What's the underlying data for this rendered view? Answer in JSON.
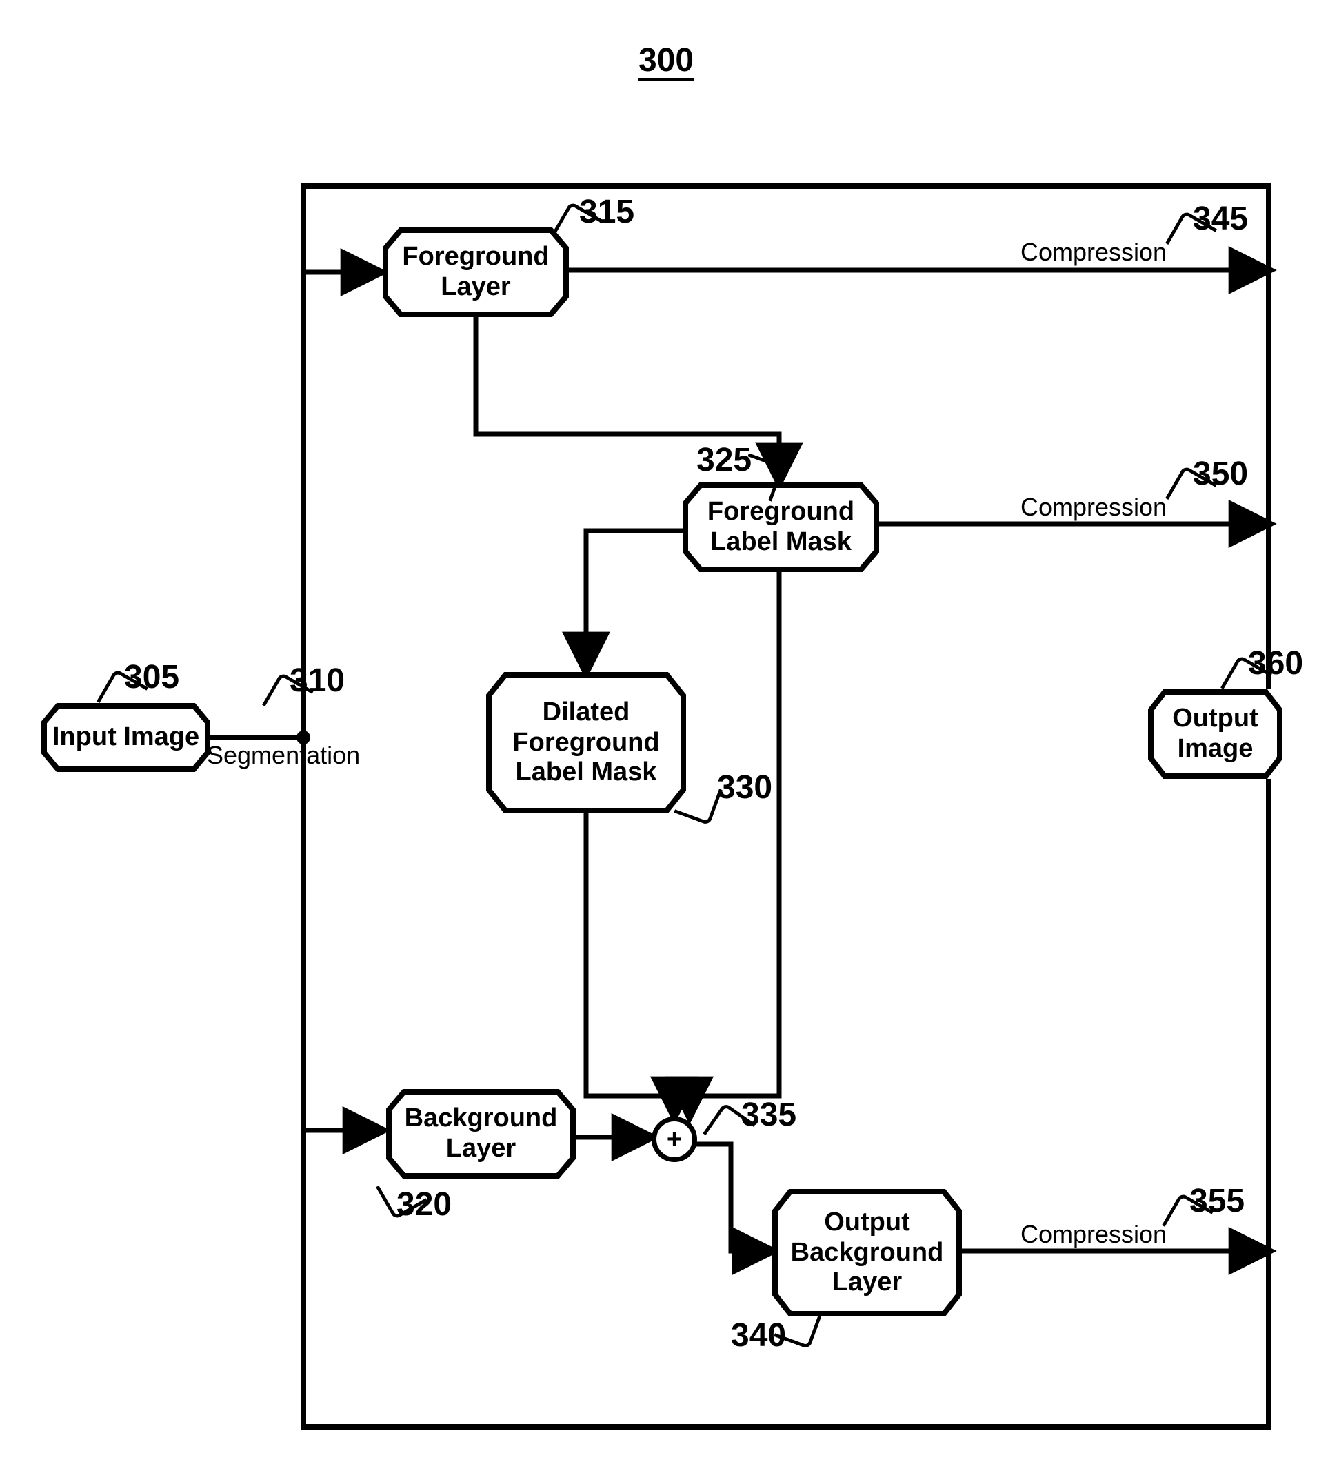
{
  "figure_number": "300",
  "nodes": {
    "input_image": {
      "ref": "305",
      "label": "Input Image"
    },
    "segmentation_edge": {
      "ref": "310",
      "label": "Segmentation"
    },
    "foreground_layer": {
      "ref": "315",
      "label": "Foreground\nLayer"
    },
    "background_layer": {
      "ref": "320",
      "label": "Background\nLayer"
    },
    "foreground_label_mask": {
      "ref": "325",
      "label": "Foreground\nLabel Mask"
    },
    "dilated_fg_label_mask": {
      "ref": "330",
      "label": "Dilated\nForeground\nLabel Mask"
    },
    "sum": {
      "ref": "335",
      "symbol": "+"
    },
    "output_bg_layer": {
      "ref": "340",
      "label": "Output\nBackground\nLayer"
    },
    "compression_fg_layer": {
      "ref": "345",
      "label": "Compression"
    },
    "compression_fg_mask": {
      "ref": "350",
      "label": "Compression"
    },
    "compression_output_bg": {
      "ref": "355",
      "label": "Compression"
    },
    "output_image": {
      "ref": "360",
      "label": "Output\nImage"
    }
  }
}
